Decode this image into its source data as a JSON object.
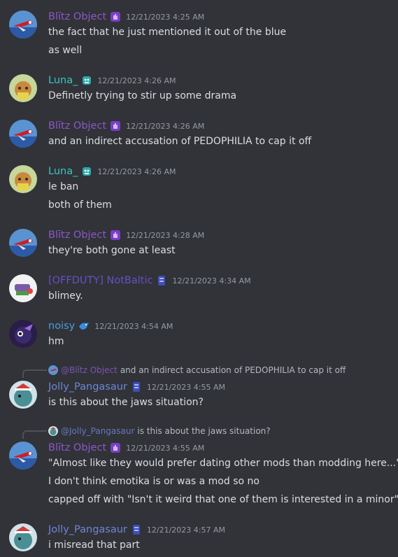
{
  "colors": {
    "blitz": "#8b57c9",
    "luna": "#3fc5c1",
    "notbaltic": "#6a4fc4",
    "noisy": "#4a9ee0",
    "jolly": "#6f84d6",
    "background": "#313338",
    "timestamp": "#949ba4",
    "text": "#dbdee1"
  },
  "messages": [
    {
      "author": "Blītz Object",
      "badge": "purple-hand-icon",
      "timestamp": "12/21/2023 4:25 AM",
      "lines": [
        "the fact that he just mentioned it out of the blue",
        "as well"
      ]
    },
    {
      "author": "Luna_",
      "badge": "teal-robot-icon",
      "timestamp": "12/21/2023 4:26 AM",
      "lines": [
        "Definetly trying to stir up some drama"
      ]
    },
    {
      "author": "Blītz Object",
      "badge": "purple-hand-icon",
      "timestamp": "12/21/2023 4:26 AM",
      "lines": [
        "and an indirect accusation of PEDOPHILIA to cap it off"
      ]
    },
    {
      "author": "Luna_",
      "badge": "teal-robot-icon",
      "timestamp": "12/21/2023 4:26 AM",
      "lines": [
        "le ban",
        "both of them"
      ]
    },
    {
      "author": "Blītz Object",
      "badge": "purple-hand-icon",
      "timestamp": "12/21/2023 4:28 AM",
      "lines": [
        "they're both gone at least"
      ]
    },
    {
      "author": "[OFFDUTY] NotBaltic",
      "badge": "blue-card-icon",
      "timestamp": "12/21/2023 4:34 AM",
      "lines": [
        "blimey."
      ]
    },
    {
      "author": "noisy",
      "badge": "blue-bird-icon",
      "timestamp": "12/21/2023 4:54 AM",
      "lines": [
        "hm"
      ]
    },
    {
      "reply": {
        "name": "@Blītz Object",
        "text": "and an indirect accusation of PEDOPHILIA to cap it off"
      },
      "author": "Jolly_Pangasaur",
      "badge": "blue-card-icon",
      "timestamp": "12/21/2023 4:55 AM",
      "lines": [
        "is this about the jaws situation?"
      ]
    },
    {
      "reply": {
        "name": "@Jolly_Pangasaur",
        "text": "is this about the jaws situation?"
      },
      "author": "Blītz Object",
      "badge": "purple-hand-icon",
      "timestamp": "12/21/2023 4:55 AM",
      "lines": [
        "\"Almost like they would prefer dating other mods than modding here...\"",
        "I don't think emotika is or was a mod so no",
        "capped off with \"Isn't it weird that one of them is interested in a minor\""
      ]
    },
    {
      "author": "Jolly_Pangasaur",
      "badge": "blue-card-icon",
      "timestamp": "12/21/2023 4:57 AM",
      "lines": [
        "i misread that part"
      ]
    }
  ]
}
